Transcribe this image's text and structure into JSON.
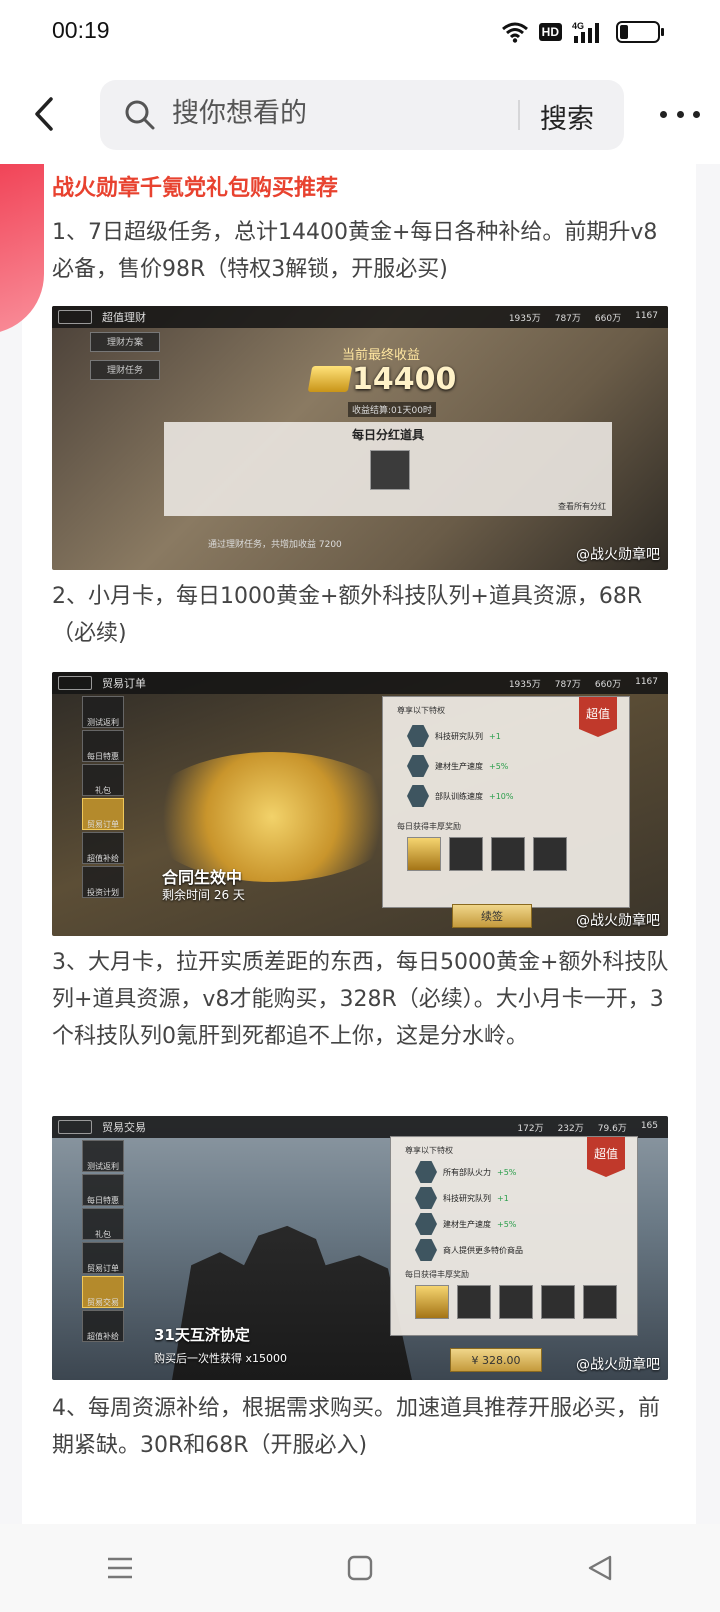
{
  "status_bar": {
    "time": "00:19",
    "hd": "HD",
    "network": "4G",
    "icons": [
      "wifi-icon",
      "hd-icon",
      "signal-icon",
      "battery-icon"
    ]
  },
  "header": {
    "search_placeholder": "搜你想看的",
    "search_button": "搜索"
  },
  "post": {
    "title": "战火勋章千氪党礼包购买推荐",
    "paragraphs": [
      "1、7日超级任务，总计14400黄金+每日各种补给。前期升v8必备，售价98R（特权3解锁，开服必买)",
      "2、小月卡，每日1000黄金+额外科技队列+道具资源，68R（必续)",
      "3、大月卡，拉开实质差距的东西，每日5000黄金+额外科技队列+道具资源，v8才能购买，328R（必续）。大小月卡一开，3个科技队列0氪肝到死都追不上你，这是分水岭。",
      "4、每周资源补给，根据需求购买。加速道具推荐开服必买，前期紧缺。30R和68R（开服必入)"
    ]
  },
  "images": {
    "watermark": "@战火勋章吧",
    "img1": {
      "title": "超值理财",
      "resources": [
        "1935万",
        "787万",
        "660万",
        "1167"
      ],
      "tabs": [
        "理财方案",
        "理财任务"
      ],
      "gold_label": "当前最终收益",
      "gold_value": "14400",
      "settle": "收益结算:01天00时",
      "panel_title": "每日分红道具",
      "panel_link": "查看所有分红",
      "footer": "通过理财任务，共增加收益 7200"
    },
    "img2": {
      "title": "贸易订单",
      "resources": [
        "1935万",
        "787万",
        "660万",
        "1167"
      ],
      "menu": [
        "测试返利",
        "每日特惠",
        "礼包",
        "贸易订单",
        "超值补给",
        "投资计划"
      ],
      "privilege_head": "尊享以下特权",
      "ribbon": "超值",
      "privileges": [
        {
          "name": "科技研究队列",
          "bonus": "+1"
        },
        {
          "name": "建材生产速度",
          "bonus": "+5%"
        },
        {
          "name": "部队训练速度",
          "bonus": "+10%"
        }
      ],
      "rewards_label": "每日获得丰厚奖励",
      "contract": "合同生效中",
      "remain": "剩余时间 26 天",
      "button": "续签"
    },
    "img3": {
      "title": "贸易交易",
      "resources": [
        "172万",
        "232万",
        "79.6万",
        "165"
      ],
      "menu": [
        "测试返利",
        "每日特惠",
        "礼包",
        "贸易订单",
        "贸易交易",
        "超值补给"
      ],
      "privilege_head": "尊享以下特权",
      "ribbon": "超值",
      "privileges": [
        {
          "name": "所有部队火力",
          "bonus": "+5%"
        },
        {
          "name": "科技研究队列",
          "bonus": "+1"
        },
        {
          "name": "建材生产速度",
          "bonus": "+5%"
        },
        {
          "name": "商人提供更多特价商品",
          "bonus": ""
        }
      ],
      "rewards_label": "每日获得丰厚奖励",
      "deal": "31天互济协定",
      "buy_once": "购买后一次性获得 x15000",
      "price": "¥ 328.00"
    }
  },
  "nav": {
    "icons": [
      "menu-icon",
      "home-icon",
      "back-triangle-icon"
    ]
  }
}
